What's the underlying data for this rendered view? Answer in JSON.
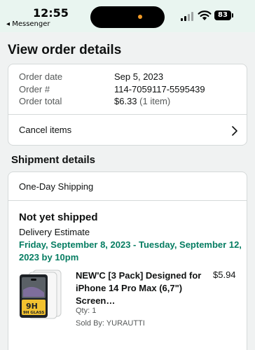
{
  "status_bar": {
    "time": "12:55",
    "back_app": "◂ Messenger",
    "battery": "83"
  },
  "page_title": "View order details",
  "order_summary": {
    "rows": [
      {
        "label": "Order date",
        "value": "Sep 5, 2023"
      },
      {
        "label": "Order #",
        "value": "114-7059117-5595439"
      },
      {
        "label": "Order total",
        "value": "$6.33",
        "extra": " (1 item)"
      }
    ],
    "cancel_label": "Cancel items"
  },
  "shipment": {
    "section_title": "Shipment details",
    "method": "One-Day Shipping",
    "status": "Not yet shipped",
    "delivery_label": "Delivery Estimate",
    "delivery_date": "Friday, September 8, 2023 - Tuesday, September 12, 2023 by 10pm",
    "item": {
      "title": "NEW'C [3 Pack] Designed for iPhone 14 Pro Max (6,7\") Screen…",
      "price": "$5.94",
      "qty": "Qty: 1",
      "seller": "Sold By: YURAUTTI",
      "thumb_text": "9H GLASS"
    }
  },
  "colors": {
    "delivery_green": "#067d62",
    "status_bar_bg": "#e9f5f0",
    "border": "#d5d9d9"
  }
}
